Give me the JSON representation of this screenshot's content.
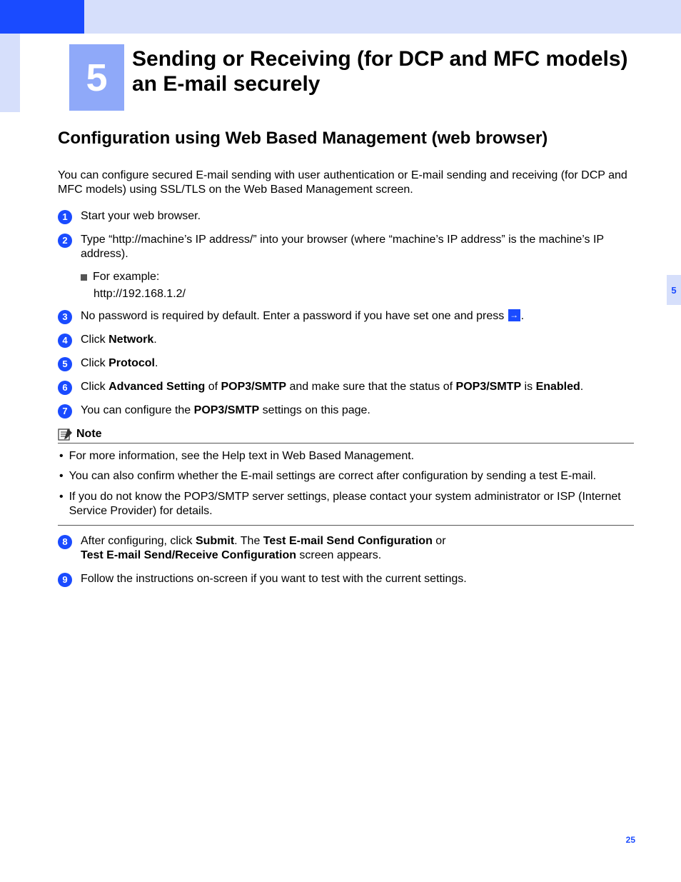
{
  "chapter": {
    "number": "5",
    "title": "Sending or Receiving (for DCP and MFC models) an E-mail securely"
  },
  "side_tab": "5",
  "section_heading": "Configuration using Web Based Management (web browser)",
  "intro": "You can configure secured E-mail sending with user authentication or E-mail sending and receiving (for DCP and MFC models) using SSL/TLS on the Web Based Management screen.",
  "steps": {
    "s1": "Start your web browser.",
    "s2": "Type “http://machine’s IP address/” into your browser (where “machine’s IP address” is the machine’s IP address).",
    "s2_example_label": "For example:",
    "s2_example_value": "http://192.168.1.2/",
    "s3_a": "No password is required by default. Enter a password if you have set one and press ",
    "s3_b": ".",
    "s4_a": "Click ",
    "s4_b": "Network",
    "s4_c": ".",
    "s5_a": "Click ",
    "s5_b": "Protocol",
    "s5_c": ".",
    "s6_a": "Click ",
    "s6_b": "Advanced Setting",
    "s6_c": " of ",
    "s6_d": "POP3/SMTP",
    "s6_e": " and make sure that the status of ",
    "s6_f": "POP3/SMTP",
    "s6_g": " is ",
    "s6_h": "Enabled",
    "s6_i": ".",
    "s7_a": "You can configure the ",
    "s7_b": "POP3/SMTP",
    "s7_c": " settings on this page.",
    "s8_a": "After configuring, click ",
    "s8_b": "Submit",
    "s8_c": ". The ",
    "s8_d": "Test E-mail Send Configuration",
    "s8_e": " or ",
    "s8_f": "Test E-mail Send/Receive Configuration",
    "s8_g": " screen appears.",
    "s9": "Follow the instructions on-screen if you want to test with the current settings."
  },
  "note": {
    "label": "Note",
    "b1": "For more information, see the Help text in Web Based Management.",
    "b2": "You can also confirm whether the E-mail settings are correct after configuration by sending a test E-mail.",
    "b3": "If you do not know the POP3/SMTP server settings, please contact your system administrator or ISP (Internet Service Provider) for details."
  },
  "page_number": "25",
  "arrow_glyph": "→"
}
